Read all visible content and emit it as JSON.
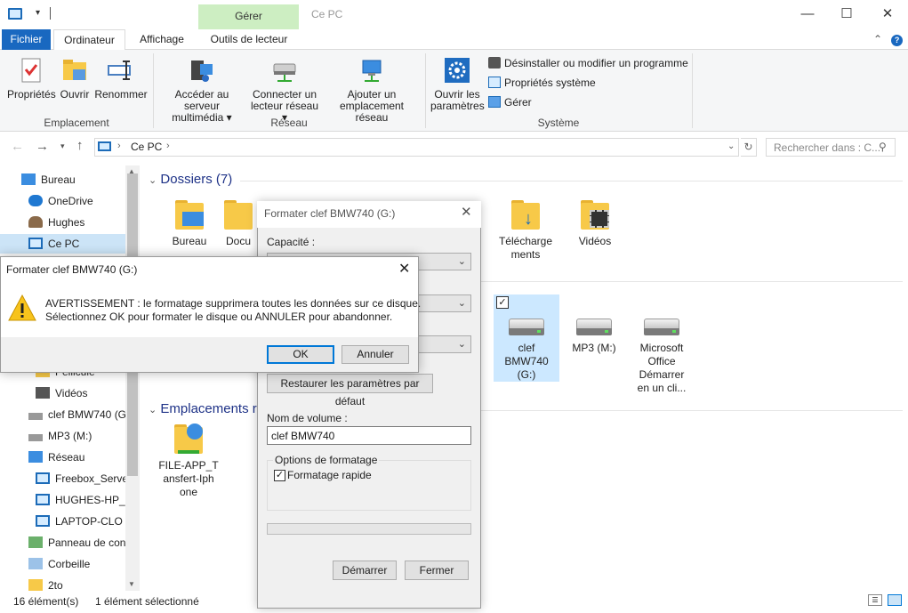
{
  "window": {
    "title": "Ce PC",
    "contextual_tab_group": "Gérer"
  },
  "ribbon": {
    "tabs": [
      "Fichier",
      "Ordinateur",
      "Affichage",
      "Outils de lecteur"
    ],
    "groups": {
      "emplacement": {
        "label": "Emplacement",
        "buttons": [
          "Propriétés",
          "Ouvrir",
          "Renommer"
        ]
      },
      "reseau": {
        "label": "Réseau",
        "buttons": [
          {
            "line1": "Accéder au serveur",
            "line2": "multimédia ▾"
          },
          {
            "line1": "Connecter un",
            "line2": "lecteur réseau ▾"
          },
          {
            "line1": "Ajouter un",
            "line2": "emplacement réseau"
          }
        ]
      },
      "systeme": {
        "label": "Système",
        "big_button": {
          "line1": "Ouvrir les",
          "line2": "paramètres"
        },
        "small_items": [
          "Désinstaller ou modifier un programme",
          "Propriétés système",
          "Gérer"
        ]
      }
    }
  },
  "address": {
    "path": "Ce PC",
    "search_placeholder": "Rechercher dans : C..."
  },
  "nav_pane": {
    "items": [
      "Bureau",
      "OneDrive",
      "Hughes",
      "Ce PC",
      "Pellicule",
      "Vidéos",
      "clef BMW740 (G:",
      "MP3 (M:)",
      "Réseau",
      "Freebox_Server",
      "HUGHES-HP_P",
      "LAPTOP-CLO",
      "Panneau de con",
      "Corbeille",
      "2to"
    ]
  },
  "content": {
    "folders_header": "Dossiers (7)",
    "folders": [
      {
        "name": "Bureau"
      },
      {
        "name": "Docu"
      },
      {
        "line1": "Télécharge",
        "line2": "ments"
      },
      {
        "name": "Vidéos"
      }
    ],
    "drives": [
      {
        "line1": "clef",
        "line2": "BMW740",
        "line3": "(G:)"
      },
      {
        "line1": "MP3 (M:)"
      },
      {
        "line1": "Microsoft",
        "line2": "Office",
        "line3": "Démarrer",
        "line4": "en un cli..."
      }
    ],
    "network_header": "Emplacements r",
    "network_items": [
      {
        "line1": "FILE-APP_T",
        "line2": "ansfert-Iph",
        "line3": "one"
      }
    ]
  },
  "status_bar": {
    "count": "16 élément(s)",
    "selected": "1 élément sélectionné"
  },
  "format_dialog": {
    "title": "Formater clef BMW740 (G:)",
    "capacity_label": "Capacité :",
    "restore_button": "Restaurer les paramètres par défaut",
    "volume_label": "Nom de volume :",
    "volume_value": "clef BMW740",
    "options_label": "Options de formatage",
    "quick_format": "Formatage rapide",
    "start_button": "Démarrer",
    "close_button": "Fermer"
  },
  "warning_dialog": {
    "title": "Formater clef BMW740 (G:)",
    "line1": "AVERTISSEMENT : le formatage supprimera toutes les données sur ce disque.",
    "line2": "Sélectionnez OK pour formater le disque ou ANNULER pour abandonner.",
    "ok": "OK",
    "cancel": "Annuler"
  }
}
